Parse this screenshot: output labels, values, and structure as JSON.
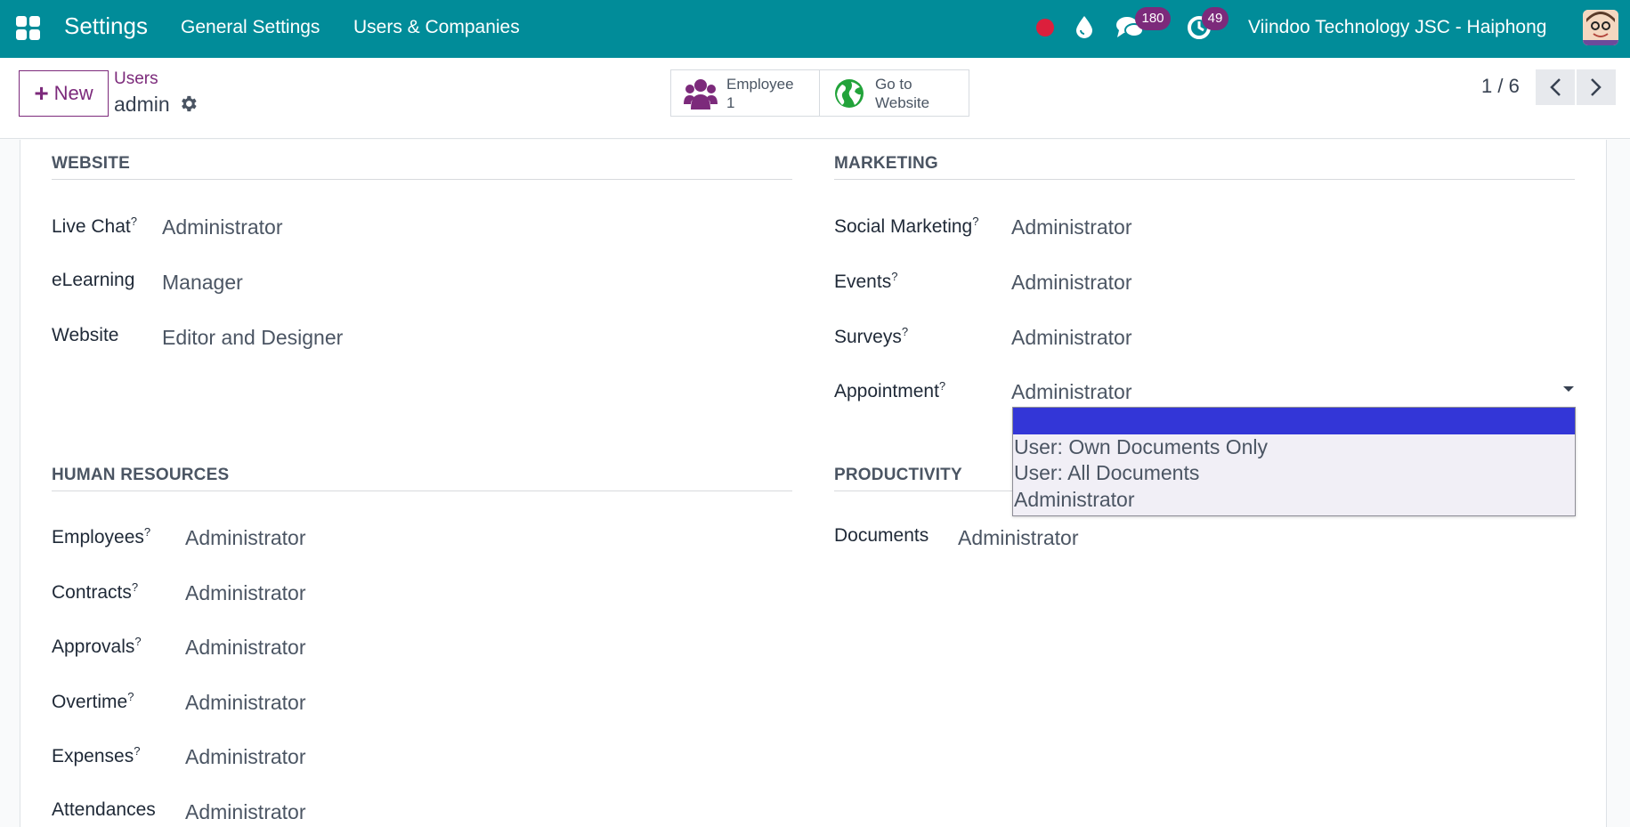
{
  "navbar": {
    "brand": "Settings",
    "menu": [
      "General Settings",
      "Users & Companies"
    ],
    "chat_count": "180",
    "activity_count": "49",
    "company": "Viindoo Technology JSC - Haiphong",
    "icons": [
      "apps-icon",
      "record-dot-icon",
      "drop-icon",
      "chat-icon",
      "clock-icon",
      "avatar"
    ]
  },
  "control_panel": {
    "new_label": "New",
    "breadcrumb_parent": "Users",
    "breadcrumb_current": "admin",
    "smart_buttons": [
      {
        "label": "Employee",
        "value": "1",
        "icon": "users-icon"
      },
      {
        "label": "Go to",
        "value": "Website",
        "icon": "globe-icon"
      }
    ],
    "pager": "1 / 6"
  },
  "sections": {
    "website": {
      "title": "WEBSITE",
      "fields": [
        {
          "label": "Live Chat",
          "help": "?",
          "value": "Administrator"
        },
        {
          "label": "eLearning",
          "help": "",
          "value": "Manager"
        },
        {
          "label": "Website",
          "help": "",
          "value": "Editor and Designer"
        }
      ]
    },
    "marketing": {
      "title": "MARKETING",
      "fields": [
        {
          "label": "Social Marketing",
          "help": "?",
          "value": "Administrator"
        },
        {
          "label": "Events",
          "help": "?",
          "value": "Administrator"
        },
        {
          "label": "Surveys",
          "help": "?",
          "value": "Administrator"
        },
        {
          "label": "Appointment",
          "help": "?",
          "value": "Administrator"
        }
      ]
    },
    "human_resources": {
      "title": "HUMAN RESOURCES",
      "fields": [
        {
          "label": "Employees",
          "help": "?",
          "value": "Administrator"
        },
        {
          "label": "Contracts",
          "help": "?",
          "value": "Administrator"
        },
        {
          "label": "Approvals",
          "help": "?",
          "value": "Administrator"
        },
        {
          "label": "Overtime",
          "help": "?",
          "value": "Administrator"
        },
        {
          "label": "Expenses",
          "help": "?",
          "value": "Administrator"
        },
        {
          "label": "Attendances",
          "help": "",
          "value": "Administrator"
        }
      ]
    },
    "productivity": {
      "title": "PRODUCTIVITY",
      "fields": [
        {
          "label": "Documents",
          "help": "",
          "value": "Administrator"
        }
      ]
    }
  },
  "dropdown": {
    "options": [
      "",
      "User: Own Documents Only",
      "User: All Documents",
      "Administrator"
    ],
    "highlighted_index": 0
  },
  "colors": {
    "navbar": "#018c99",
    "primary": "#7c2a7b",
    "dropdown_highlight": "#3336d7"
  }
}
